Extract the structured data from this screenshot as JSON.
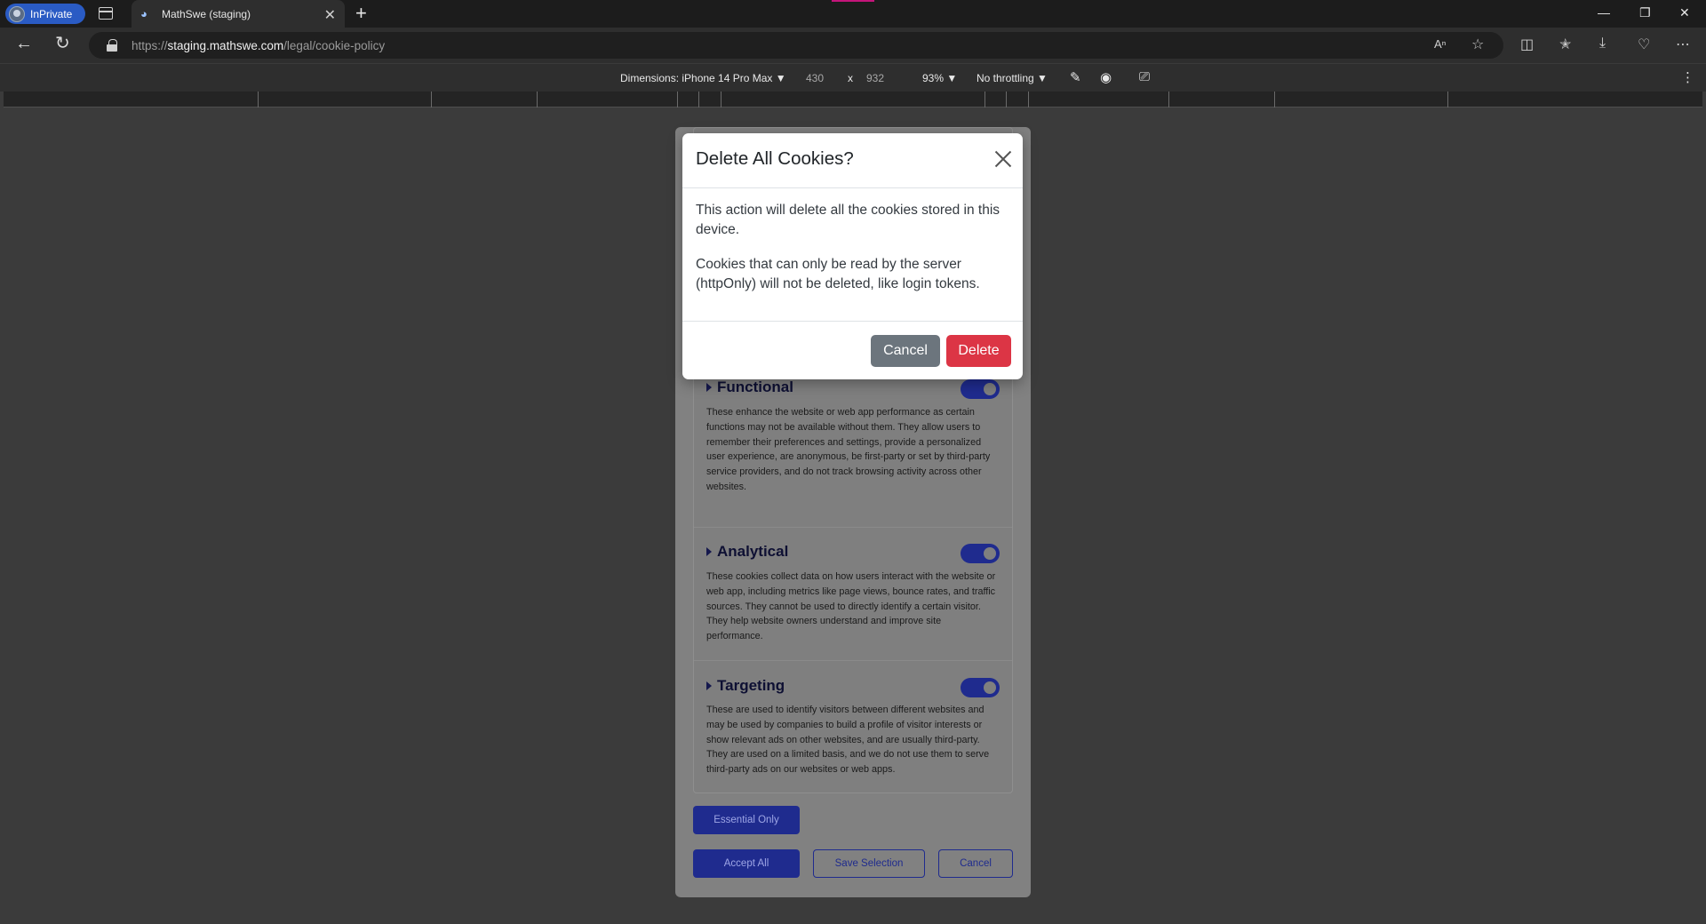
{
  "browser": {
    "inprivate_label": "InPrivate",
    "tab_title": "MathSwe (staging)",
    "url_scheme": "https://",
    "url_host": "staging.mathswe.com",
    "url_path": "/legal/cookie-policy"
  },
  "devtools": {
    "dimensions_label": "Dimensions: iPhone 14 Pro Max",
    "width": "430",
    "times": "x",
    "height": "932",
    "zoom": "93%",
    "throttling": "No throttling"
  },
  "sections": [
    {
      "title": "Functional",
      "enabled": true,
      "description": "These enhance the website or web app performance as certain functions may not be available without them. They allow users to remember their preferences and settings, provide a personalized user experience, are anonymous, be first-party or set by third-party service providers, and do not track browsing activity across other websites."
    },
    {
      "title": "Analytical",
      "enabled": true,
      "description": "These cookies collect data on how users interact with the website or web app, including metrics like page views, bounce rates, and traffic sources. They cannot be used to directly identify a certain visitor. They help website owners understand and improve site performance."
    },
    {
      "title": "Targeting",
      "enabled": true,
      "description": "These are used to identify visitors between different websites and may be used by companies to build a profile of visitor interests or show relevant ads on other websites, and are usually third-party. They are used on a limited basis, and we do not use them to serve third-party ads on our websites or web apps."
    }
  ],
  "actions": {
    "essential_only": "Essential Only",
    "accept_all": "Accept All",
    "save_selection": "Save Selection",
    "cancel": "Cancel"
  },
  "modal": {
    "title": "Delete All Cookies?",
    "paragraph_1": "This action will delete all the cookies stored in this device.",
    "paragraph_2": "Cookies that can only be read by the server (httpOnly) will not be deleted, like login tokens.",
    "cancel_label": "Cancel",
    "delete_label": "Delete"
  },
  "colors": {
    "primary": "#1f2b8e",
    "danger": "#dc3545",
    "secondary": "#6c757d",
    "inprivate": "#2a5bc4"
  }
}
